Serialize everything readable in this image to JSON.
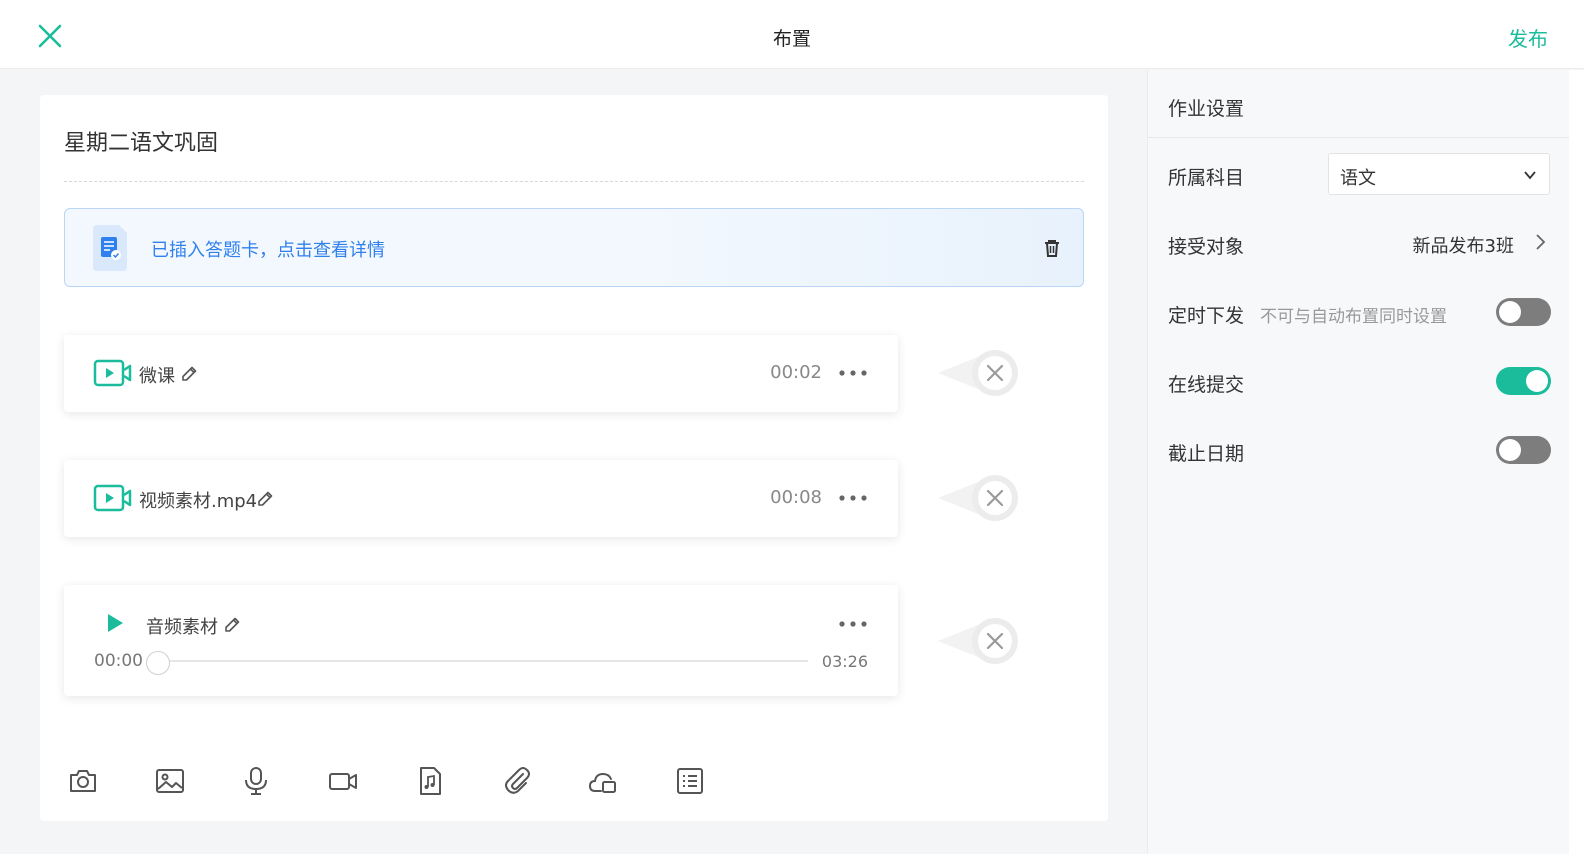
{
  "header": {
    "title": "布置",
    "publish_label": "发布"
  },
  "homework": {
    "title": "星期二语文巩固",
    "answer_card_text": "已插入答题卡，点击查看详情"
  },
  "media": [
    {
      "type": "video",
      "name": "微课",
      "duration": "00:02"
    },
    {
      "type": "video",
      "name": "视频素材.mp4",
      "duration": "00:08"
    },
    {
      "type": "audio",
      "name": "音频素材",
      "current_time": "00:00",
      "duration": "03:26",
      "progress": 0
    }
  ],
  "toolbar": {
    "tools": [
      "camera-icon",
      "image-icon",
      "microphone-icon",
      "video-camera-icon",
      "music-file-icon",
      "attachment-icon",
      "cloud-device-icon",
      "list-icon"
    ]
  },
  "settings": {
    "title": "作业设置",
    "subject_label": "所属科目",
    "subject_value": "语文",
    "receiver_label": "接受对象",
    "receiver_value": "新品发布3班",
    "scheduled_label": "定时下发",
    "scheduled_hint": "不可与自动布置同时设置",
    "scheduled_on": false,
    "online_label": "在线提交",
    "online_on": true,
    "deadline_label": "截止日期",
    "deadline_on": false
  },
  "colors": {
    "accent": "#1abc9c",
    "link_blue": "#2f80ed",
    "toggle_off": "#7d7d7d"
  }
}
